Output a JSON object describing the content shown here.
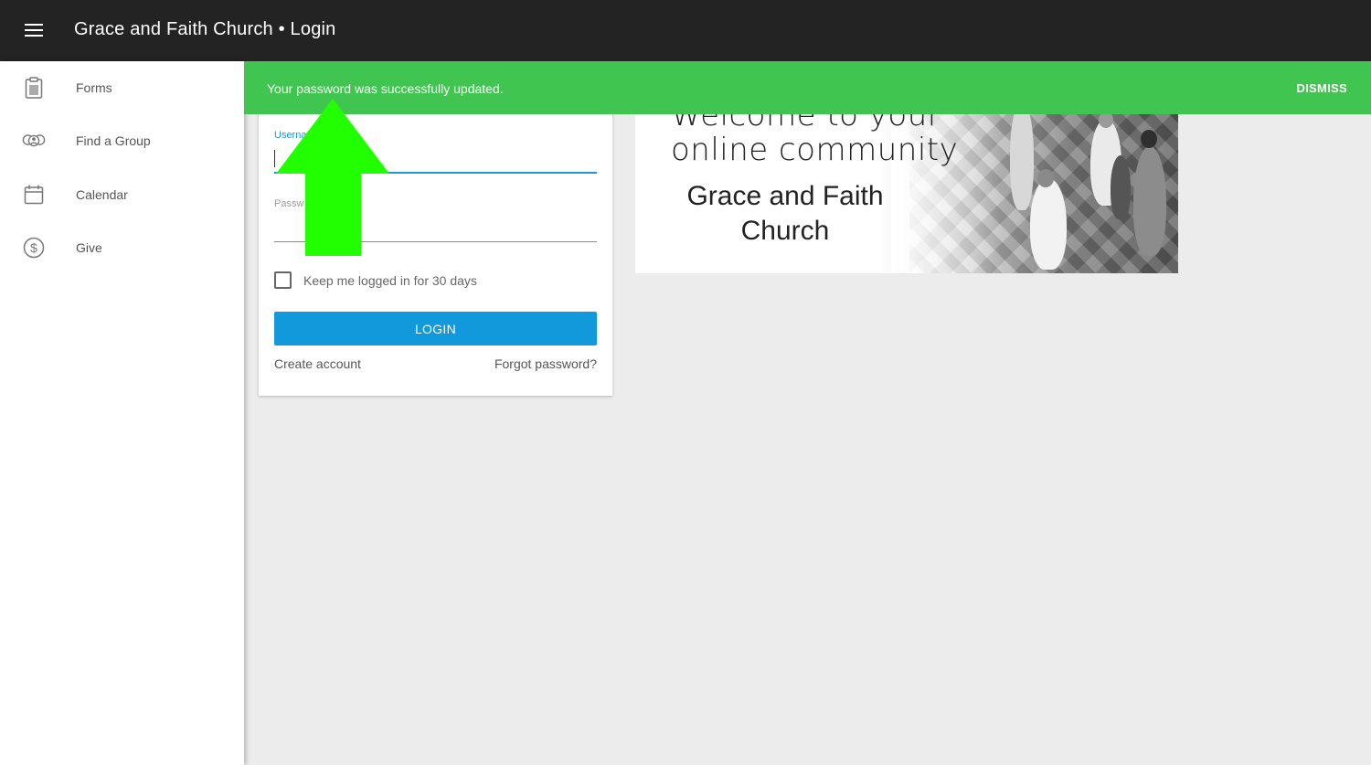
{
  "header": {
    "title": "Grace and Faith Church • Login",
    "menu_icon": "hamburger-menu-icon"
  },
  "sidebar": {
    "items": [
      {
        "label": "Forms",
        "icon": "clipboard-icon"
      },
      {
        "label": "Find a Group",
        "icon": "group-icon"
      },
      {
        "label": "Calendar",
        "icon": "calendar-icon"
      },
      {
        "label": "Give",
        "icon": "dollar-circle-icon"
      }
    ]
  },
  "notification": {
    "message": "Your password was successfully updated.",
    "dismiss_label": "DISMISS",
    "color": "#40c650"
  },
  "login_form": {
    "username_label": "Userna",
    "username_value": "",
    "password_label": "Passw",
    "password_value": "",
    "keep_logged_in_label": "Keep me logged in for 30 days",
    "keep_logged_in_checked": false,
    "login_button": "LOGIN",
    "create_account": "Create account",
    "forgot_password": "Forgot password?",
    "accent_color": "#1299dc"
  },
  "hero": {
    "line1": "Welcome to your",
    "line2": "online community",
    "church_name": "Grace and Faith Church"
  },
  "annotation": {
    "arrow_color": "#22ff00",
    "arrow_direction": "up"
  }
}
